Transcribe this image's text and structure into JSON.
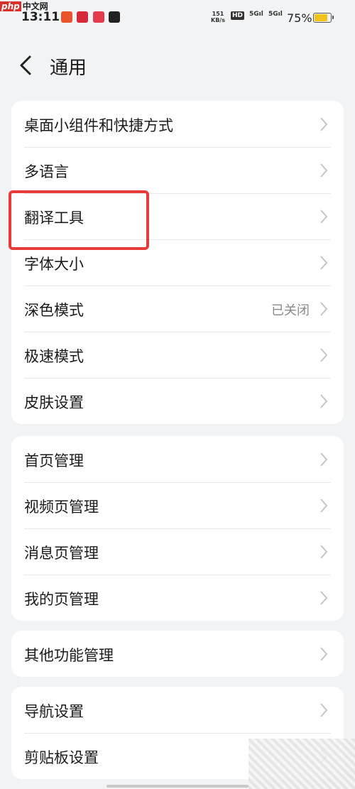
{
  "status_bar": {
    "time": "13:11",
    "network_speed_value": "151",
    "network_speed_unit": "KB/s",
    "hd_label": "HD",
    "signal1": "5G",
    "signal2": "5G",
    "battery_percent": "75%",
    "battery_level": 0.75,
    "watermark_php": "php",
    "watermark_cn": "中文网"
  },
  "header": {
    "title": "通用",
    "back_icon": "chevron-left-icon"
  },
  "groups": [
    {
      "items": [
        {
          "label": "桌面小组件和快捷方式",
          "value": ""
        },
        {
          "label": "多语言",
          "value": ""
        },
        {
          "label": "翻译工具",
          "value": ""
        },
        {
          "label": "字体大小",
          "value": ""
        },
        {
          "label": "深色模式",
          "value": "已关闭"
        },
        {
          "label": "极速模式",
          "value": ""
        },
        {
          "label": "皮肤设置",
          "value": ""
        }
      ]
    },
    {
      "items": [
        {
          "label": "首页管理",
          "value": ""
        },
        {
          "label": "视频页管理",
          "value": ""
        },
        {
          "label": "消息页管理",
          "value": ""
        },
        {
          "label": "我的页管理",
          "value": ""
        }
      ]
    },
    {
      "items": [
        {
          "label": "其他功能管理",
          "value": ""
        }
      ]
    },
    {
      "items": [
        {
          "label": "导航设置",
          "value": ""
        },
        {
          "label": "剪贴板设置",
          "value": ""
        }
      ]
    }
  ],
  "colors": {
    "background": "#f1f3f5",
    "card": "#ffffff",
    "highlight_border": "#e53b3b",
    "chevron": "#c4c4c4",
    "battery": "#f0c21c"
  }
}
